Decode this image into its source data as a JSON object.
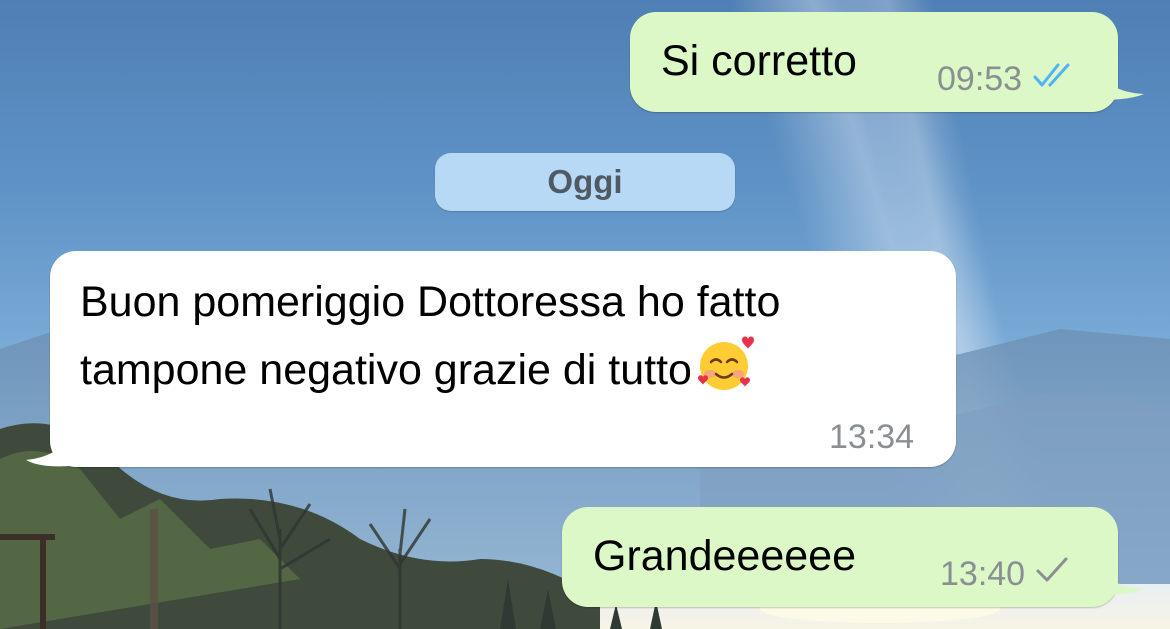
{
  "chat": {
    "date_separator": "Oggi",
    "messages": [
      {
        "direction": "outgoing",
        "text": "Si corretto",
        "time": "09:53",
        "status": "read",
        "status_icon": "double-check-icon",
        "status_color": "#4fb3f5"
      },
      {
        "direction": "incoming",
        "lines": [
          "Buon pomeriggio Dottoressa ho fatto",
          "tampone negativo grazie di tutto"
        ],
        "emoji": "🥰",
        "emoji_icon": "smiling-face-with-hearts-icon",
        "time": "13:34"
      },
      {
        "direction": "outgoing",
        "text": "Grandeeeeee",
        "time": "13:40",
        "status": "sent",
        "status_icon": "single-check-icon",
        "status_color": "#8a8f94"
      }
    ]
  },
  "colors": {
    "outgoing_bubble": "#dcf8c6",
    "incoming_bubble": "#ffffff",
    "date_pill": "#b8d9f5",
    "read_check": "#4fb3f5",
    "meta_text": "#8a8f94"
  }
}
